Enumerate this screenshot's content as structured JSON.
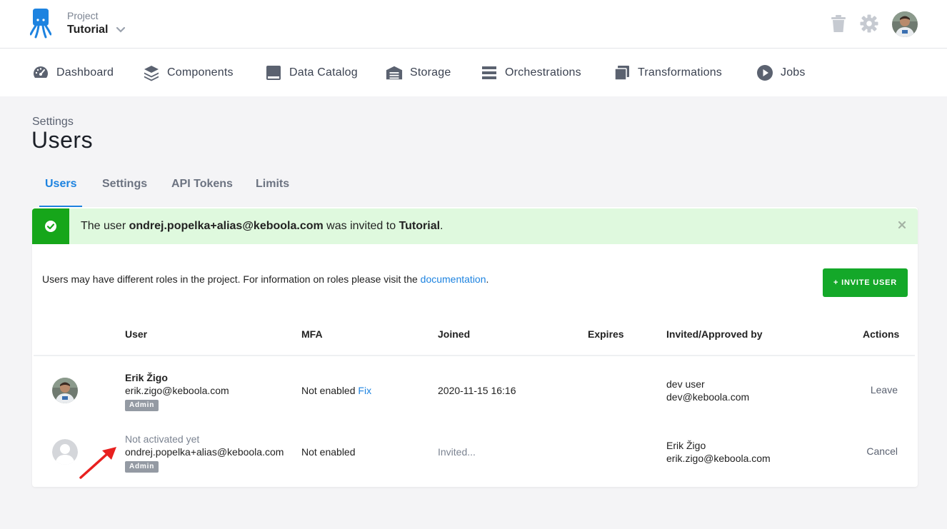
{
  "project": {
    "label": "Project",
    "name": "Tutorial"
  },
  "header_icons": [
    "trash-icon",
    "gear-icon",
    "user-avatar"
  ],
  "nav": [
    {
      "label": "Dashboard",
      "icon": "dashboard-icon"
    },
    {
      "label": "Components",
      "icon": "components-icon"
    },
    {
      "label": "Data Catalog",
      "icon": "data-catalog-icon"
    },
    {
      "label": "Storage",
      "icon": "storage-icon"
    },
    {
      "label": "Orchestrations",
      "icon": "orchestrations-icon"
    },
    {
      "label": "Transformations",
      "icon": "transformations-icon"
    },
    {
      "label": "Jobs",
      "icon": "jobs-icon"
    }
  ],
  "page": {
    "breadcrumb": "Settings",
    "title": "Users"
  },
  "tabs": [
    {
      "label": "Users",
      "active": true
    },
    {
      "label": "Settings",
      "active": false
    },
    {
      "label": "API Tokens",
      "active": false
    },
    {
      "label": "Limits",
      "active": false
    }
  ],
  "alert": {
    "prefix": "The user ",
    "email": "ondrej.popelka+alias@keboola.com",
    "middle": " was invited to ",
    "project": "Tutorial",
    "suffix": "."
  },
  "info": {
    "text": "Users may have different roles in the project. For information on roles please visit the ",
    "link": "documentation",
    "end": "."
  },
  "invite_button": "+ INVITE USER",
  "table": {
    "headers": [
      "User",
      "MFA",
      "Joined",
      "Expires",
      "Invited/Approved by",
      "Actions"
    ],
    "rows": [
      {
        "name": "Erik Žigo",
        "email": "erik.zigo@keboola.com",
        "role": "Admin",
        "mfa": "Not enabled",
        "mfa_fix": "Fix",
        "joined": "2020-11-15 16:16",
        "expires": "",
        "approved_name": "dev user",
        "approved_email": "dev@keboola.com",
        "action": "Leave"
      },
      {
        "name": "Not activated yet",
        "email": "ondrej.popelka+alias@keboola.com",
        "role": "Admin",
        "mfa": "Not enabled",
        "joined": "Invited...",
        "expires": "",
        "approved_name": "Erik Žigo",
        "approved_email": "erik.zigo@keboola.com",
        "action": "Cancel"
      }
    ]
  },
  "colors": {
    "accent": "#1d83e0",
    "success": "#16a61a",
    "alert_bg": "#dff9de",
    "button": "#14a829",
    "annotation_arrow": "#e8201f"
  }
}
